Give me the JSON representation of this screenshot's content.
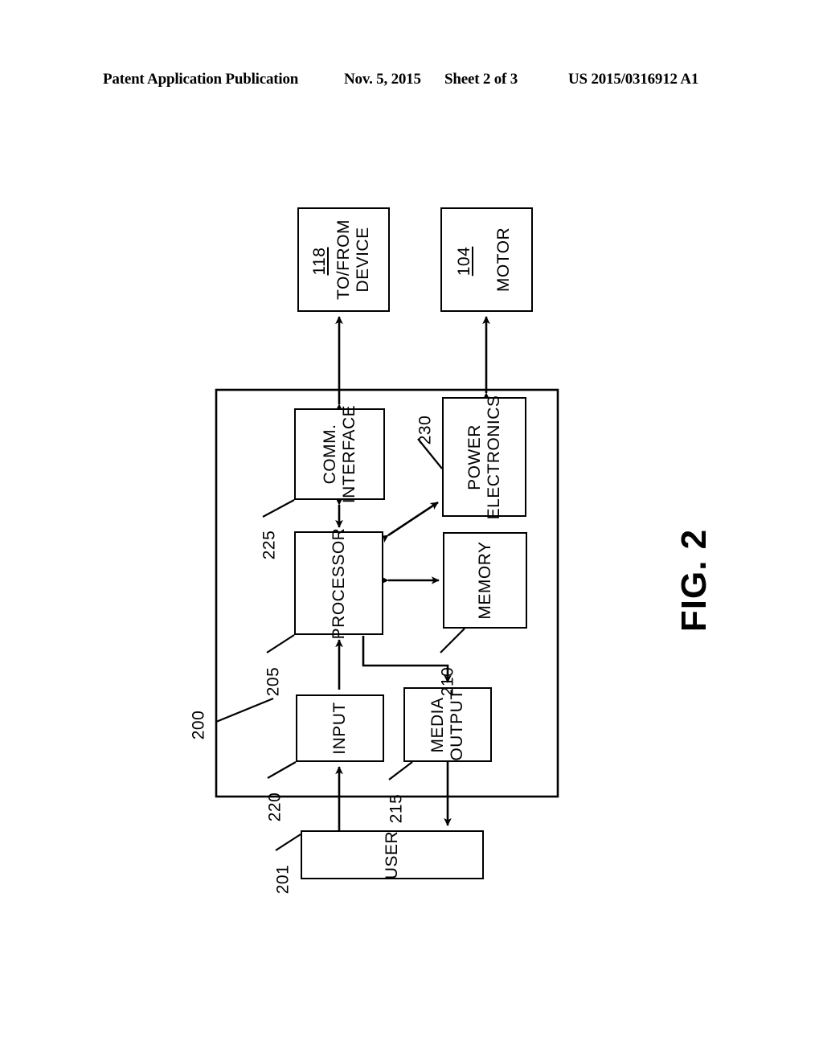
{
  "header": {
    "publication": "Patent Application Publication",
    "date": "Nov. 5, 2015",
    "sheet": "Sheet 2 of 3",
    "patent_number": "US 2015/0316912 A1"
  },
  "figure": {
    "caption": "FIG. 2",
    "system_ref": "200"
  },
  "blocks": [
    {
      "id": "to-from-device",
      "label": "TO/FROM\nDEVICE",
      "ref": "118",
      "ref_style": "inside-underlined"
    },
    {
      "id": "motor",
      "label": "MOTOR",
      "ref": "104",
      "ref_style": "inside-underlined"
    },
    {
      "id": "comm-interface",
      "label": "COMM.\nINTERFACE",
      "ref": "225",
      "ref_style": "leader"
    },
    {
      "id": "power-electronics",
      "label": "POWER\nELECTRONICS",
      "ref": "230",
      "ref_style": "leader"
    },
    {
      "id": "processor",
      "label": "PROCESSOR",
      "ref": "205",
      "ref_style": "leader"
    },
    {
      "id": "memory",
      "label": "MEMORY",
      "ref": "210",
      "ref_style": "leader"
    },
    {
      "id": "input",
      "label": "INPUT",
      "ref": "220",
      "ref_style": "leader"
    },
    {
      "id": "media-output",
      "label": "MEDIA\nOUTPUT",
      "ref": "215",
      "ref_style": "leader"
    },
    {
      "id": "user",
      "label": "USER",
      "ref": "201",
      "ref_style": "leader"
    }
  ],
  "labels": {
    "to_from_device_line1": "TO/FROM",
    "to_from_device_line2": "DEVICE",
    "motor": "MOTOR",
    "comm_interface_line1": "COMM.",
    "comm_interface_line2": "INTERFACE",
    "power_electronics_line1": "POWER",
    "power_electronics_line2": "ELECTRONICS",
    "processor": "PROCESSOR",
    "memory": "MEMORY",
    "input": "INPUT",
    "media_output_line1": "MEDIA",
    "media_output_line2": "OUTPUT",
    "user": "USER"
  },
  "refs": {
    "device": "118",
    "motor": "104",
    "comm_interface": "225",
    "power_electronics": "230",
    "processor": "205",
    "memory": "210",
    "input": "220",
    "media_output": "215",
    "user": "201",
    "system": "200"
  },
  "colors": {
    "ink": "#000000",
    "paper": "#ffffff"
  }
}
